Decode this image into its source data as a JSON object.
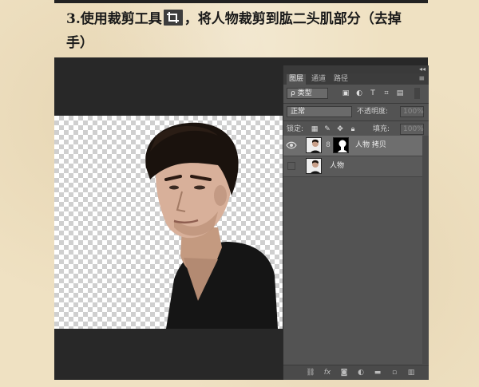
{
  "instruction": {
    "step": "3.",
    "text_before": "使用裁剪工具",
    "text_after": "，将人物裁剪到肱二头肌部分（去掉",
    "text_line2": "手）"
  },
  "layers_panel": {
    "tabs": [
      "图层",
      "通道",
      "路径"
    ],
    "filter_select": "ρ 类型",
    "blend_mode": "正常",
    "opacity_label": "不透明度:",
    "opacity_value": "100%",
    "lock_label": "锁定:",
    "fill_label": "填充:",
    "fill_value": "100%",
    "layers": [
      {
        "name": "人物 拷贝",
        "visible": true,
        "has_mask": true
      },
      {
        "name": "人物",
        "visible": false,
        "has_mask": false
      }
    ]
  },
  "colors": {
    "paper": "#efe1c2",
    "workspace": "#282828",
    "panel": "#535353"
  },
  "icons": [
    "crop-icon",
    "eye-icon",
    "chain-link-icon",
    "fx-icon",
    "mask-icon",
    "adjustment-icon",
    "folder-icon",
    "new-layer-icon",
    "trash-icon"
  ]
}
